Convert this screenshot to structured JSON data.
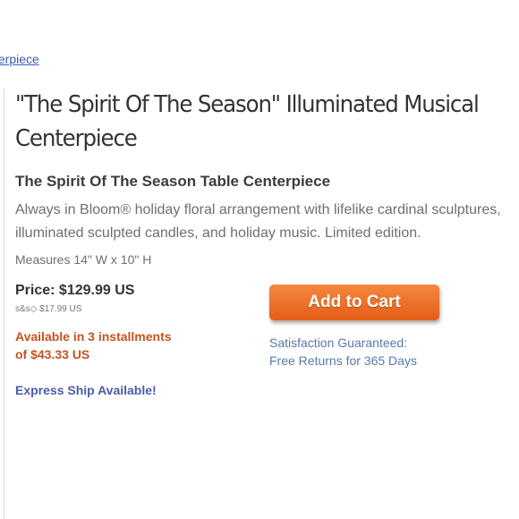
{
  "breadcrumb": {
    "text": "terpiece"
  },
  "product": {
    "title_line1": "\"The Spirit Of The Season\" Illuminated Musical",
    "title_line2": "Centerpiece",
    "subtitle": "The Spirit Of The Season Table Centerpiece",
    "desc_line1": "Always in Bloom® holiday floral arrangement with lifelike cardinal sculptures,",
    "desc_line2": "illuminated sculpted candles, and holiday music. Limited edition.",
    "measures": "Measures 14\" W x 10\" H"
  },
  "pricing": {
    "price": "Price: $129.99 US",
    "shipping": "s&s◇ $17.99 US",
    "installments_line1": "Available in 3 installments",
    "installments_line2": "of $43.33 US",
    "express": "Express Ship Available!"
  },
  "cart": {
    "add_label": "Add to Cart",
    "guarantee_line1": "Satisfaction Guaranteed:",
    "guarantee_line2": "Free Returns for 365 Days"
  },
  "colors": {
    "accent_orange": "#e45d15",
    "installments_text": "#c6531f",
    "link_blue": "#3b5bb5",
    "express_blue": "#4a5da8"
  }
}
